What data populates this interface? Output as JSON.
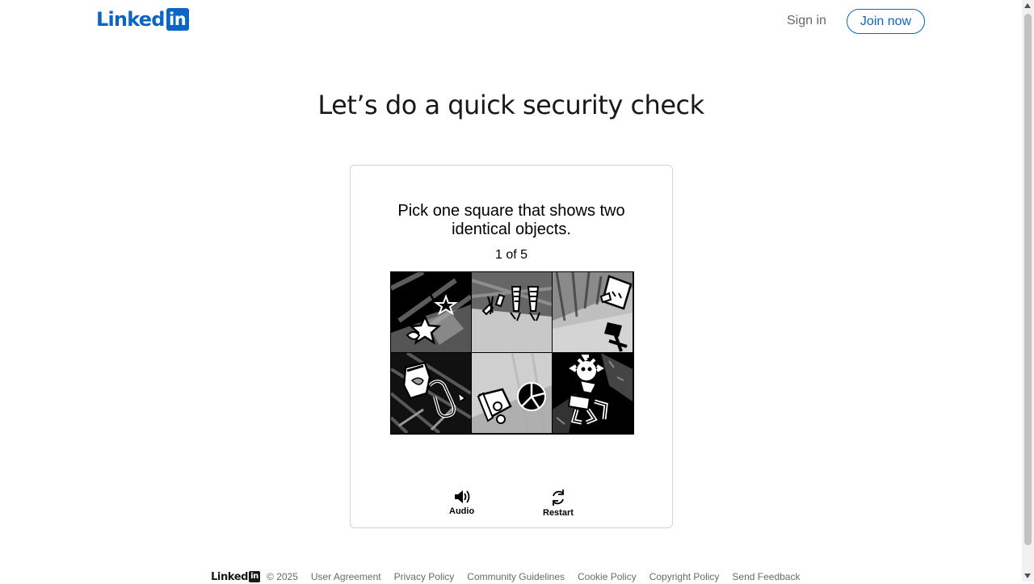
{
  "header": {
    "logo_text": "Linked",
    "logo_box": "in",
    "sign_in_label": "Sign in",
    "join_now_label": "Join now"
  },
  "page_title": "Let’s do a quick security check",
  "captcha": {
    "prompt_line1": "Pick one square that shows two",
    "prompt_line2": "identical objects.",
    "counter": "1 of 5",
    "audio_label": "Audio",
    "restart_label": "Restart"
  },
  "footer": {
    "logo_text": "Linked",
    "logo_box": "in",
    "copyright": "© 2025",
    "links": [
      "User Agreement",
      "Privacy Policy",
      "Community Guidelines",
      "Cookie Policy",
      "Copyright Policy",
      "Send Feedback"
    ]
  },
  "colors": {
    "brand": "#0a66c2",
    "text": "#000000e6",
    "muted": "#00000099"
  }
}
